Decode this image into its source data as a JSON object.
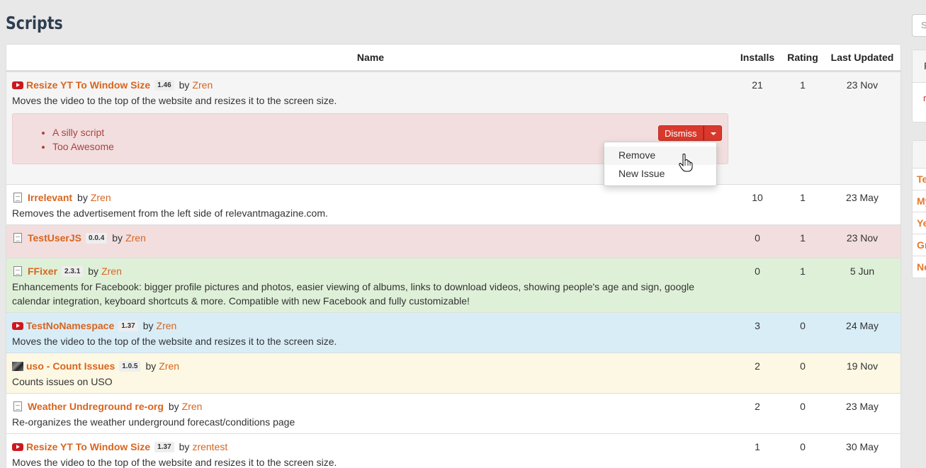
{
  "page": {
    "title": "Scripts"
  },
  "search": {
    "placeholder": "S"
  },
  "side": {
    "panel_header": "F",
    "panel_body": "r",
    "list_items": [
      "Te",
      "My",
      "Ye",
      "Gr",
      "Ne"
    ]
  },
  "table": {
    "headers": {
      "name": "Name",
      "installs": "Installs",
      "rating": "Rating",
      "updated": "Last Updated"
    },
    "rows": [
      {
        "icon": "youtube-icon",
        "name": "Resize YT To Window Size",
        "version": "1.46",
        "by": "by",
        "author": "Zren",
        "description": "Moves the video to the top of the website and resizes it to the screen size.",
        "installs": "21",
        "rating": "1",
        "updated": "23 Nov",
        "row_color": "#f5f5f5"
      },
      {
        "icon": "file-icon",
        "name": "Irrelevant",
        "version": "",
        "by": "by",
        "author": "Zren",
        "description": "Removes the advertisement from the left side of relevantmagazine.com.",
        "installs": "10",
        "rating": "1",
        "updated": "23 May",
        "row_color": "#ffffff"
      },
      {
        "icon": "file-icon",
        "name": "TestUserJS",
        "version": "0.0.4",
        "by": "by",
        "author": "Zren",
        "description": "",
        "installs": "0",
        "rating": "1",
        "updated": "23 Nov",
        "row_color": "#f2dede"
      },
      {
        "icon": "file-icon",
        "name": "FFixer",
        "version": "2.3.1",
        "by": "by",
        "author": "Zren",
        "description": "Enhancements for Facebook: bigger profile pictures and photos, easier viewing of albums, links to download videos, showing people's age and sign, google calendar integration, keyboard shortcuts & more. Compatible with new Facebook and fully customizable!",
        "installs": "0",
        "rating": "1",
        "updated": "5 Jun",
        "row_color": "#dff0d8"
      },
      {
        "icon": "youtube-icon",
        "name": "TestNoNamespace",
        "version": "1.37",
        "by": "by",
        "author": "Zren",
        "description": "Moves the video to the top of the website and resizes it to the screen size.",
        "installs": "3",
        "rating": "0",
        "updated": "24 May",
        "row_color": "#d9edf7"
      },
      {
        "icon": "image-icon",
        "name": "uso - Count Issues",
        "version": "1.0.5",
        "by": "by",
        "author": "Zren",
        "description": "Counts issues on USO",
        "installs": "2",
        "rating": "0",
        "updated": "19 Nov",
        "row_color": "#fcf8e3"
      },
      {
        "icon": "file-icon",
        "name": "Weather Undreground re-org",
        "version": "",
        "by": "by",
        "author": "Zren",
        "description": "Re-organizes the weather underground forecast/conditions page",
        "installs": "2",
        "rating": "0",
        "updated": "23 May",
        "row_color": "#ffffff"
      },
      {
        "icon": "youtube-icon",
        "name": "Resize YT To Window Size",
        "version": "1.37",
        "by": "by",
        "author": "zrentest",
        "description": "Moves the video to the top of the website and resizes it to the screen size.",
        "installs": "1",
        "rating": "0",
        "updated": "30 May",
        "row_color": "#ffffff"
      }
    ]
  },
  "alert": {
    "issues": [
      "A silly script",
      "Too Awesome"
    ],
    "dismiss_label": "Dismiss"
  },
  "dropdown": {
    "items": [
      "Remove",
      "New Issue"
    ]
  },
  "colors": {
    "link": "#d9641e",
    "danger_button": "#d9382d",
    "title": "#2d3e50"
  }
}
